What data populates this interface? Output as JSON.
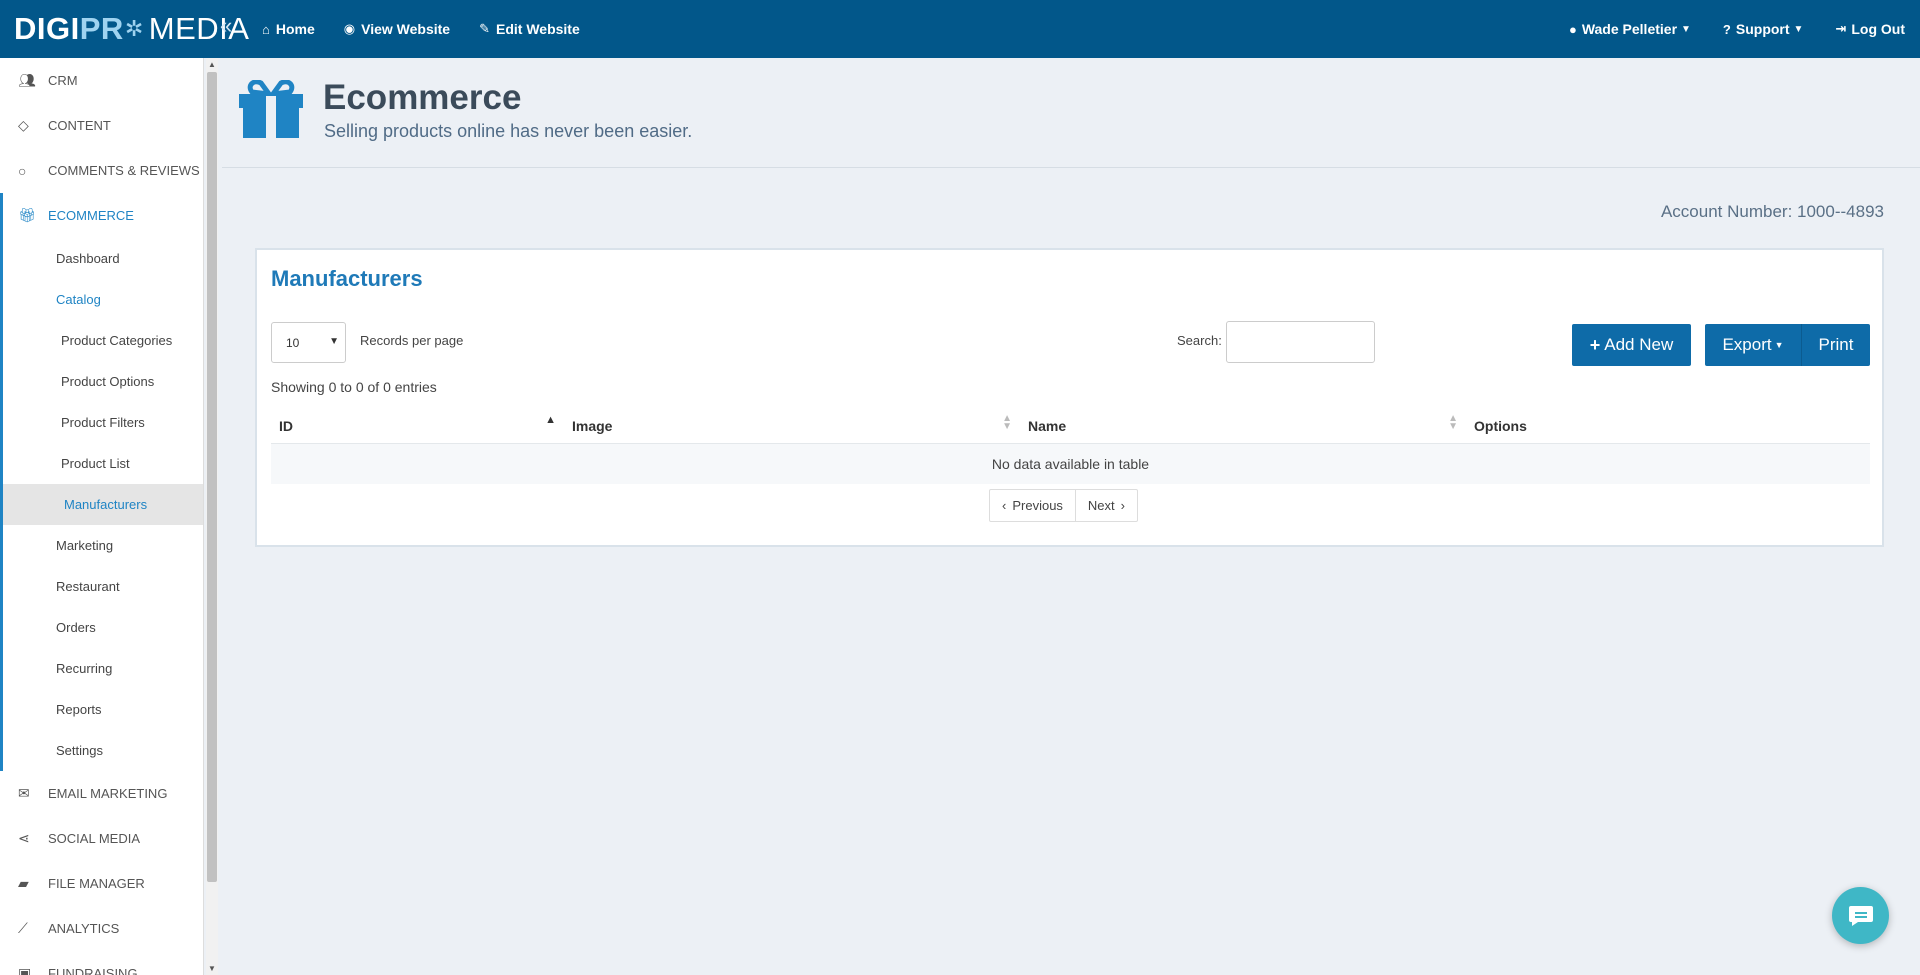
{
  "brand": {
    "part1": "DIGI",
    "part2": "PR",
    "part3": "MEDIA"
  },
  "topnav": {
    "home": "Home",
    "view_website": "View Website",
    "edit_website": "Edit Website"
  },
  "topright": {
    "user": "Wade Pelletier",
    "support": "Support",
    "logout": "Log Out"
  },
  "sidebar": {
    "crm": "CRM",
    "content": "CONTENT",
    "comments": "COMMENTS & REVIEWS",
    "ecommerce": "ECOMMERCE",
    "ecom_items": {
      "dashboard": "Dashboard",
      "catalog": "Catalog",
      "product_categories": "Product Categories",
      "product_options": "Product Options",
      "product_filters": "Product Filters",
      "product_list": "Product List",
      "manufacturers": "Manufacturers",
      "marketing": "Marketing",
      "restaurant": "Restaurant",
      "orders": "Orders",
      "recurring": "Recurring",
      "reports": "Reports",
      "settings": "Settings"
    },
    "email_marketing": "EMAIL MARKETING",
    "social_media": "SOCIAL MEDIA",
    "file_manager": "FILE MANAGER",
    "analytics": "ANALYTICS",
    "fundraising": "FUNDRAISING"
  },
  "page": {
    "title": "Ecommerce",
    "subtitle": "Selling products online has never been easier."
  },
  "account": "Account Number: 1000--4893",
  "panel": {
    "title": "Manufacturers",
    "records_per_page_value": "10",
    "records_per_page_label": "Records per page",
    "search_label": "Search:",
    "add_new": "Add New",
    "export": "Export",
    "print": "Print",
    "showing": "Showing 0 to 0 of 0 entries",
    "columns": [
      "ID",
      "Image",
      "Name",
      "Options"
    ],
    "empty": "No data available in table",
    "previous": "Previous",
    "next": "Next"
  },
  "colors": {
    "topbar": "#02578a",
    "accent": "#1f84c4",
    "button": "#0e6ba8",
    "chat": "#3fb7c6"
  }
}
